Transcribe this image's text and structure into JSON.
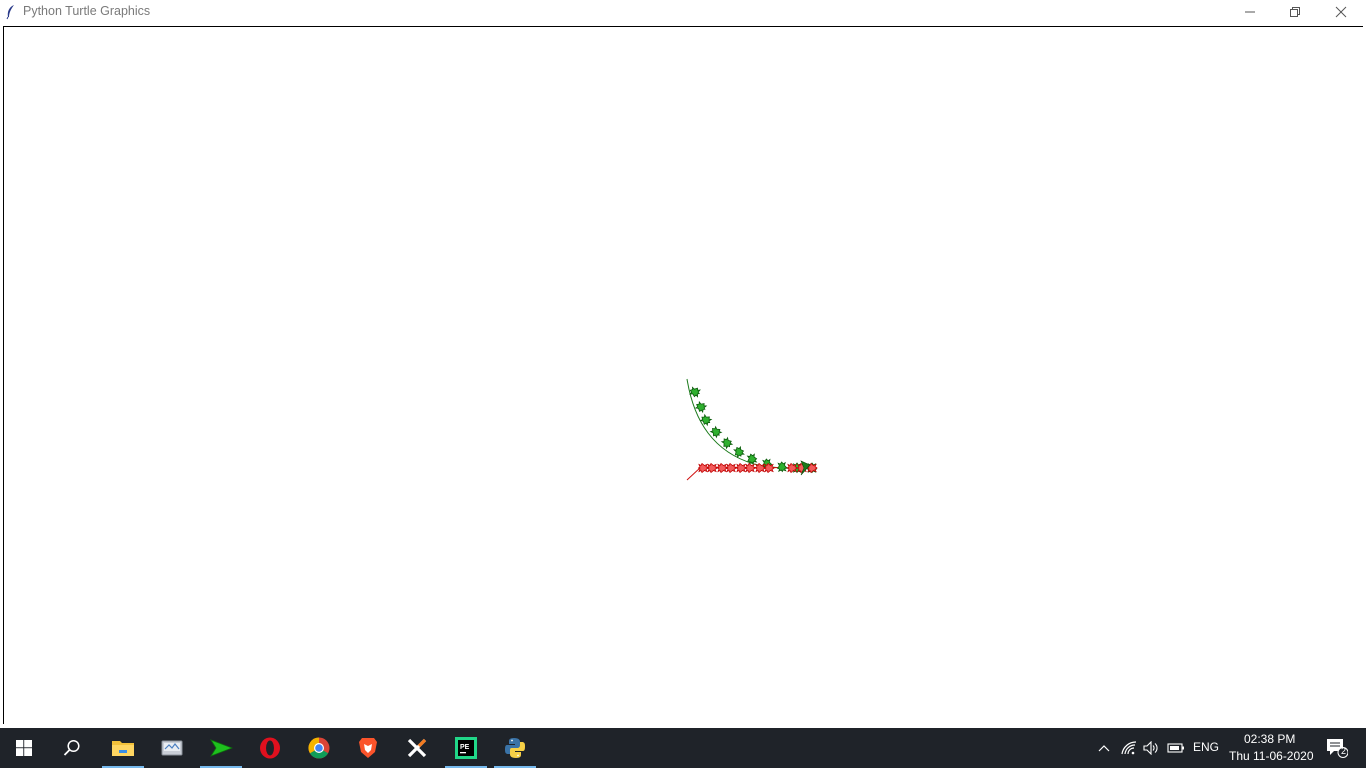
{
  "window": {
    "title": "Python Turtle Graphics"
  },
  "taskbar": {
    "apps": [
      {
        "name": "start",
        "icon": "windows-logo-icon"
      },
      {
        "name": "search",
        "icon": "search-icon"
      },
      {
        "name": "file-explorer",
        "icon": "folder-icon"
      },
      {
        "name": "app-generic",
        "icon": "disk-utility-icon"
      },
      {
        "name": "arrow-app",
        "icon": "green-arrow-icon"
      },
      {
        "name": "opera",
        "icon": "opera-icon"
      },
      {
        "name": "chrome",
        "icon": "chrome-icon"
      },
      {
        "name": "brave",
        "icon": "brave-icon"
      },
      {
        "name": "xampp",
        "icon": "xampp-icon"
      },
      {
        "name": "pycharm",
        "icon": "pycharm-icon"
      },
      {
        "name": "python",
        "icon": "python-icon"
      }
    ],
    "tray": {
      "language": "ENG",
      "time": "02:38 PM",
      "date": "Thu 11-06-2020",
      "notification_count": "2"
    }
  },
  "colors": {
    "green_stamp": "#1a9a1a",
    "red_stamp": "#d01010",
    "taskbar_bg": "#1f2329"
  }
}
